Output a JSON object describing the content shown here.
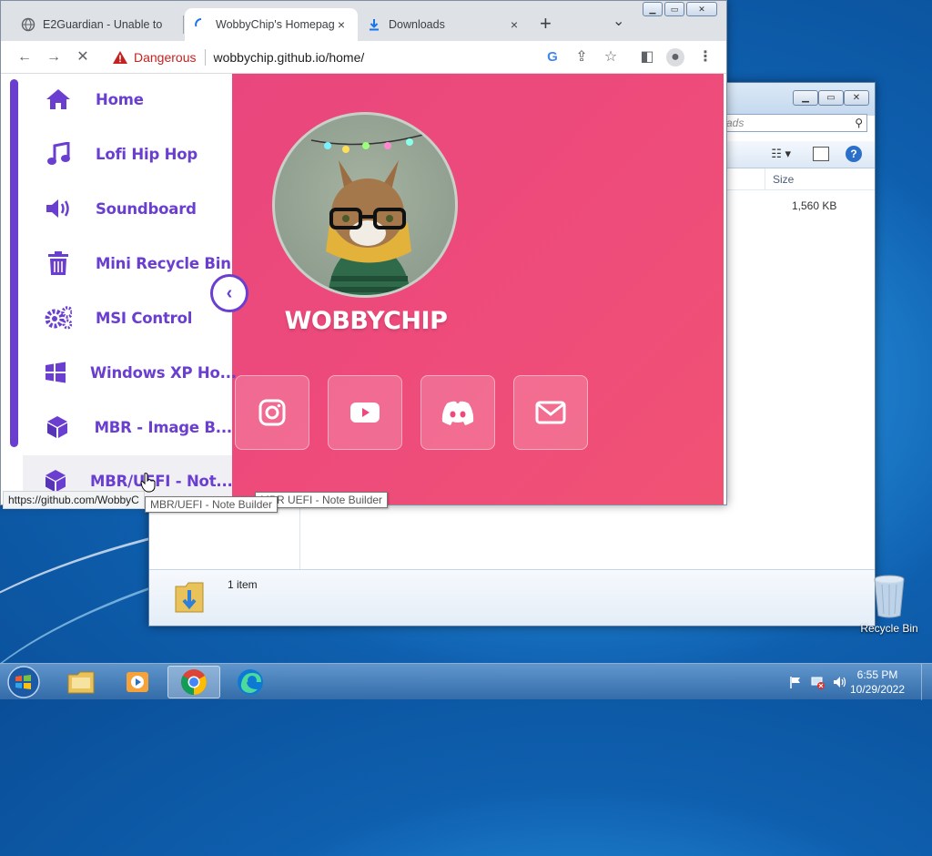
{
  "browser": {
    "tabs": [
      {
        "title": "E2Guardian - Unable to",
        "close": "×"
      },
      {
        "title": "WobbyChip's Homepage",
        "close": "×"
      },
      {
        "title": "Downloads",
        "close": "×"
      }
    ],
    "new_tab": "+",
    "tab_search": "⌄",
    "security_label": "Dangerous",
    "url": "wobbychip.github.io/home/",
    "status_url": "https://github.com/WobbyC",
    "tooltip_1": "MBR/UEFI - Note Builder",
    "tooltip_2": "MBR UEFI - Note Builder"
  },
  "site": {
    "brand": "WOBBYCHIP",
    "nav": [
      {
        "label": "Home",
        "icon": "home-icon"
      },
      {
        "label": "Lofi Hip Hop",
        "icon": "music-note-icon"
      },
      {
        "label": "Soundboard",
        "icon": "speaker-icon"
      },
      {
        "label": "Mini Recycle Bin",
        "icon": "trash-icon"
      },
      {
        "label": "MSI Control",
        "icon": "gears-icon"
      },
      {
        "label": "Windows XP Ho...",
        "icon": "windows-icon"
      },
      {
        "label": "MBR - Image B...",
        "icon": "cube-icon"
      },
      {
        "label": "MBR/UEFI - Not...",
        "icon": "cube-icon"
      }
    ],
    "social": [
      "instagram-icon",
      "youtube-icon",
      "discord-icon",
      "mail-icon"
    ],
    "colors": {
      "accent": "#6a3fd0",
      "background": "#ec4a7c"
    }
  },
  "explorer": {
    "search_placeholder": "ads",
    "column_size": "Size",
    "file_size": "1,560 KB",
    "item_count": "1 item"
  },
  "desktop": {
    "recycle_bin": "Recycle Bin"
  },
  "taskbar": {
    "time": "6:55 PM",
    "date": "10/29/2022"
  }
}
